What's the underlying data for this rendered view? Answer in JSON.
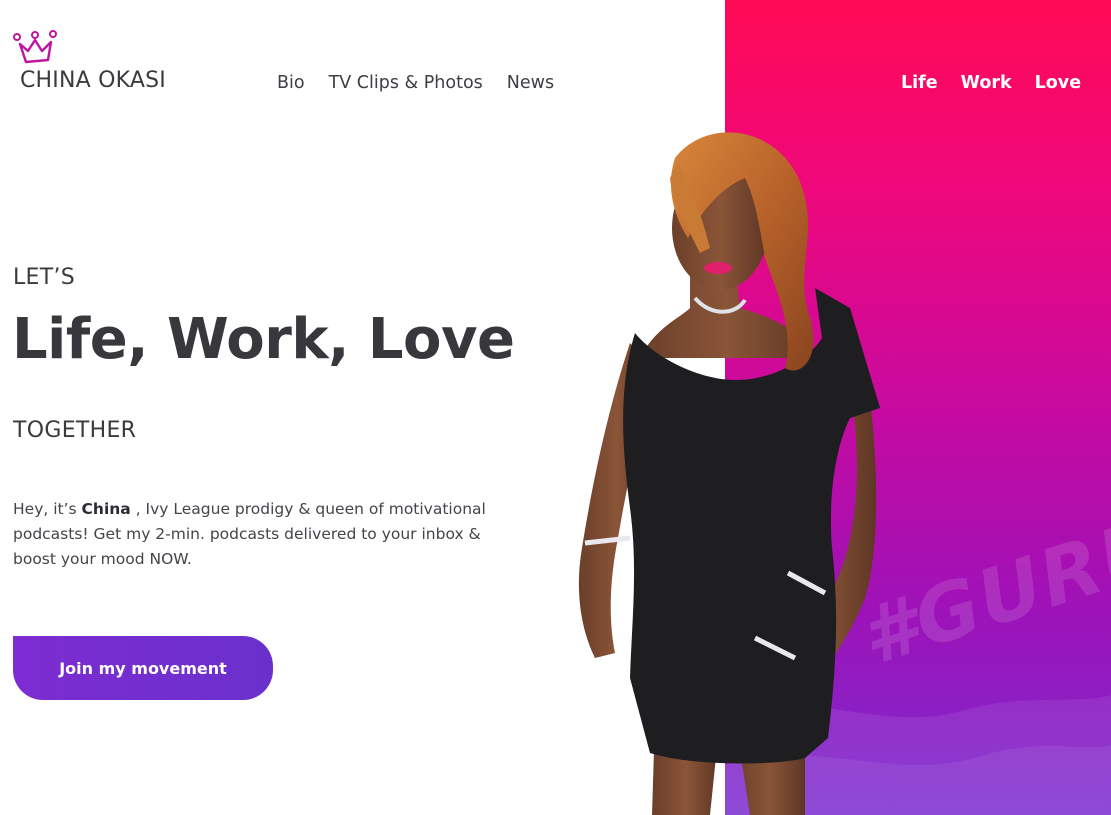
{
  "brand": {
    "name": "CHINA OKASI",
    "crown_color": "#c0169e"
  },
  "main_nav": {
    "items": [
      {
        "label": "Bio"
      },
      {
        "label": "TV Clips & Photos"
      },
      {
        "label": "News"
      }
    ]
  },
  "right_nav": {
    "items": [
      {
        "label": "Life"
      },
      {
        "label": "Work"
      },
      {
        "label": "Love"
      }
    ]
  },
  "hero": {
    "eyebrow": "LET’S",
    "headline": "Life, Work, Love",
    "subline": "TOGETHER",
    "intro_before": "Hey, it’s ",
    "intro_name": "China",
    "intro_after": " , Ivy League prodigy & queen of motivational podcasts! Get my 2-min. podcasts delivered to your inbox & boost your mood NOW.",
    "cta_label": "Join my movement"
  },
  "panel": {
    "watermark": "#GURU"
  },
  "colors": {
    "accent_gradient_top": "#ff0a55",
    "accent_gradient_bottom": "#7a2dd0",
    "cta": "#7d2cd2",
    "text_dark": "#37373c"
  }
}
